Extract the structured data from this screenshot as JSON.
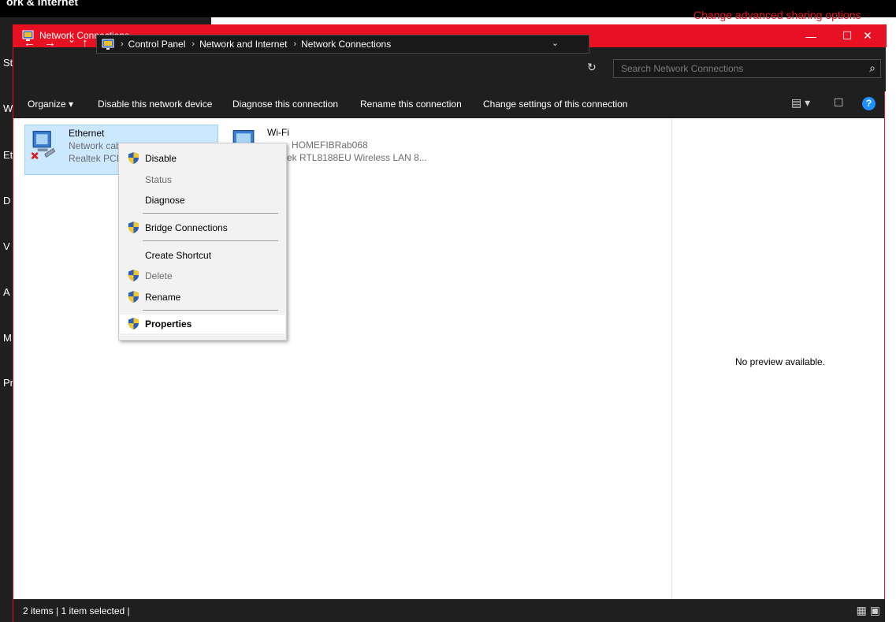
{
  "background": {
    "title": "ork & Internet",
    "link": "Change advanced sharing options",
    "side_letters": [
      "St",
      "W",
      "Et",
      "D",
      "V",
      "A",
      "M",
      "Pr"
    ]
  },
  "window": {
    "title": "Network Connections",
    "minimize": "—",
    "maximize": "☐",
    "close": "✕"
  },
  "nav": {
    "back": "←",
    "forward": "→",
    "recent": "⌄",
    "up": "↑"
  },
  "address": {
    "crumbs": [
      "Control Panel",
      "Network and Internet",
      "Network Connections"
    ],
    "separator": "›",
    "dropdown": "⌄",
    "refresh": "↻"
  },
  "search": {
    "placeholder": "Search Network Connections",
    "icon": "⌕"
  },
  "toolbar": {
    "organize": "Organize ▾",
    "disable": "Disable this network device",
    "diagnose": "Diagnose this connection",
    "rename": "Rename this connection",
    "change_settings": "Change settings of this connection",
    "view_icon": "▤ ▾",
    "pane_icon": "☐",
    "help": "?"
  },
  "items": [
    {
      "name": "Ethernet",
      "line1": "Network cab",
      "line2": "Realtek PCIe"
    },
    {
      "name": "Wi-Fi",
      "line1": "HOMEFIBRab068",
      "line2": "ek RTL8188EU Wireless LAN 8..."
    }
  ],
  "context_menu": {
    "disable": "Disable",
    "status": "Status",
    "diagnose": "Diagnose",
    "bridge": "Bridge Connections",
    "shortcut": "Create Shortcut",
    "delete": "Delete",
    "rename": "Rename",
    "properties": "Properties"
  },
  "preview": {
    "text": "No preview available."
  },
  "status": {
    "text": "2 items  |  1 item selected  |",
    "icons": "▦ ▣"
  },
  "colors": {
    "accent": "#e81123",
    "dark": "#1f1f1f",
    "selection": "#cce8ff"
  }
}
